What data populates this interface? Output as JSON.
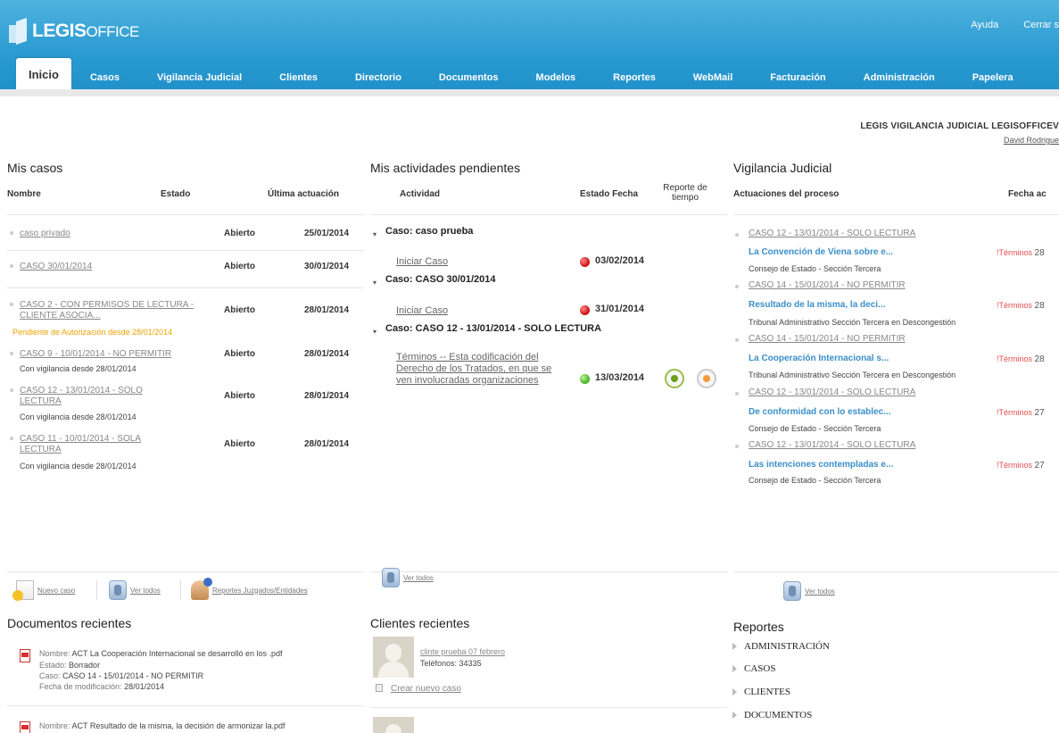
{
  "header": {
    "logo_bold": "LEGIS",
    "logo_thin": "OFFICE",
    "help": "Ayuda",
    "logout": "Cerrar s"
  },
  "nav": [
    "Inicio",
    "Casos",
    "Vigilancia Judicial",
    "Clientes",
    "Directorio",
    "Documentos",
    "Modelos",
    "Reportes",
    "WebMail",
    "Facturación",
    "Administración",
    "Papelera"
  ],
  "user": {
    "company": "LEGIS VIGILANCIA JUDICIAL LEGISOFFICEV",
    "name": "David Rodrigue"
  },
  "mis_casos": {
    "title": "Mis casos",
    "col_name": "Nombre",
    "col_state": "Estado",
    "col_last": "Última actuación",
    "rows": [
      {
        "name": "caso privado",
        "state": "Abierto",
        "date": "25/01/2014"
      },
      {
        "name": "CASO 30/01/2014",
        "state": "Abierto",
        "date": "30/01/2014"
      },
      {
        "name": "CASO 2 - CON PERMISOS DE LECTURA - CLIENTE ASOCIA...",
        "state": "Abierto",
        "date": "28/01/2014",
        "sub": "Pendiente de Autorización desde 28/01/2014"
      },
      {
        "name": "CASO 9 - 10/01/2014 - NO PERMITIR",
        "state": "Abierto",
        "date": "28/01/2014",
        "sub": "Con vigilancia desde 28/01/2014"
      },
      {
        "name": "CASO 12 - 13/01/2014 - SOLO LECTURA",
        "state": "Abierto",
        "date": "28/01/2014",
        "sub": "Con vigilancia desde 28/01/2014"
      },
      {
        "name": "CASO 11 - 10/01/2014 - SOLA LECTURA",
        "state": "Abierto",
        "date": "28/01/2014",
        "sub": "Con vigilancia desde 28/01/2014"
      }
    ],
    "actions": [
      "Nuevo caso",
      "Ver todos",
      "Reportes Juzgados/Entidades"
    ]
  },
  "actividades": {
    "title": "Mis actividades pendientes",
    "col_activity": "Actividad",
    "col_state_date": "Estado Fecha",
    "col_time": "Reporte de tiempo",
    "groups": [
      {
        "case": "Caso: caso prueba",
        "activity": "Iniciar Caso",
        "status": "red",
        "date": "03/02/2014"
      },
      {
        "case": "Caso: CASO 30/01/2014",
        "activity": "Iniciar Caso",
        "status": "red",
        "date": "31/01/2014"
      },
      {
        "case": "Caso: CASO 12 - 13/01/2014 - SOLO LECTURA",
        "activity": "Términos -- Esta codificación del Derecho de los Tratados, en que se ven involucradas organizaciones",
        "status": "green",
        "date": "13/03/2014"
      }
    ],
    "view_all": "Ver todos"
  },
  "vigilancia": {
    "title": "Vigilancia Judicial",
    "col_actions": "Actuaciones del proceso",
    "col_date": "Fecha ac",
    "items": [
      {
        "case": "CASO 12 - 13/01/2014 - SOLO LECTURA",
        "title": "La Convención de Viena sobre e...",
        "court": "Consejo de Estado - Sección Tercera",
        "term": "!Términos",
        "date": "28"
      },
      {
        "case": "CASO 14 - 15/01/2014 - NO PERMITIR",
        "title": "Resultado de la misma, la deci...",
        "court": "Tribunal Administrativo Sección Tercera en Descongestión",
        "term": "!Términos",
        "date": "28"
      },
      {
        "case": "CASO 14 - 15/01/2014 - NO PERMITIR",
        "title": "La Cooperación Internacional s...",
        "court": "Tribunal Administrativo Sección Tercera en Descongestión",
        "term": "!Términos",
        "date": "28"
      },
      {
        "case": "CASO 12 - 13/01/2014 - SOLO LECTURA",
        "title": "De conformidad con lo establec...",
        "court": "Consejo de Estado - Sección Tercera",
        "term": "!Términos",
        "date": "27"
      },
      {
        "case": "CASO 12 - 13/01/2014 - SOLO LECTURA",
        "title": "Las intenciones contempladas e...",
        "court": "Consejo de Estado - Sección Tercera",
        "term": "!Términos",
        "date": "27"
      }
    ],
    "view_all": "Ver todos"
  },
  "documentos": {
    "title": "Documentos recientes",
    "doc1": {
      "name_label": "Nombre:",
      "name": "ACT La Cooperación Internacional se desarrolló en los .pdf",
      "state_label": "Estado:",
      "state": "Borrador",
      "case_label": "Caso:",
      "case": "CASO 14 - 15/01/2014 - NO PERMITIR",
      "date_label": "Fecha de modificación:",
      "date": "28/01/2014"
    },
    "doc2": {
      "name_label": "Nombre:",
      "name": "ACT Resultado de la misma, la decisión de armonizar la.pdf"
    }
  },
  "clientes": {
    "title": "Clientes recientes",
    "client_name": "clinte prueba 07 febrero",
    "phone_label": "Teléfonos:",
    "phone": "34335",
    "new_case": "Crear nuevo caso"
  },
  "reportes": {
    "title": "Reportes",
    "items": [
      "ADMINISTRACIÓN",
      "CASOS",
      "CLIENTES",
      "DOCUMENTOS"
    ]
  }
}
